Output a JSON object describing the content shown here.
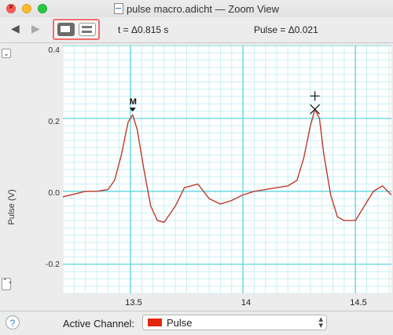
{
  "window": {
    "title": "pulse macro.adicht — Zoom View",
    "close_glyph": "×"
  },
  "toolbar": {
    "back_glyph": "◀",
    "forward_glyph": "▶",
    "time_readout": "t = Δ0.815 s",
    "value_readout": "Pulse = Δ0.021"
  },
  "plot": {
    "ylabel": "Pulse (V)",
    "yticks": [
      "0.4",
      "0.2",
      "0.0",
      "-0.2"
    ],
    "xticks": [
      "13.5",
      "14",
      "14.5"
    ],
    "marker_label": "M",
    "collapse_glyph": "⌄",
    "scale_glyph": "⌃⌄"
  },
  "bottom": {
    "help_label": "?",
    "active_channel_label": "Active Channel:",
    "channel_name": "Pulse",
    "channel_color": "#e2260e"
  },
  "chart_data": {
    "type": "line",
    "xlim": [
      13.2,
      14.66
    ],
    "ylim": [
      -0.28,
      0.4
    ],
    "grid": true,
    "trace_color": "#c0392b",
    "x": [
      13.2,
      13.3,
      13.35,
      13.4,
      13.43,
      13.46,
      13.49,
      13.51,
      13.53,
      13.56,
      13.59,
      13.62,
      13.65,
      13.7,
      13.74,
      13.8,
      13.85,
      13.9,
      13.95,
      14.0,
      14.05,
      14.1,
      14.15,
      14.2,
      14.24,
      14.27,
      14.3,
      14.32,
      14.34,
      14.36,
      14.39,
      14.42,
      14.45,
      14.5,
      14.54,
      14.58,
      14.62,
      14.66
    ],
    "y": [
      -0.015,
      0.0,
      0.0,
      0.005,
      0.03,
      0.1,
      0.19,
      0.21,
      0.17,
      0.06,
      -0.04,
      -0.08,
      -0.085,
      -0.04,
      0.01,
      0.02,
      -0.02,
      -0.035,
      -0.025,
      -0.01,
      0.0,
      0.005,
      0.01,
      0.015,
      0.03,
      0.09,
      0.18,
      0.225,
      0.2,
      0.1,
      -0.01,
      -0.07,
      -0.08,
      -0.08,
      -0.04,
      0.0,
      0.015,
      -0.01
    ]
  }
}
